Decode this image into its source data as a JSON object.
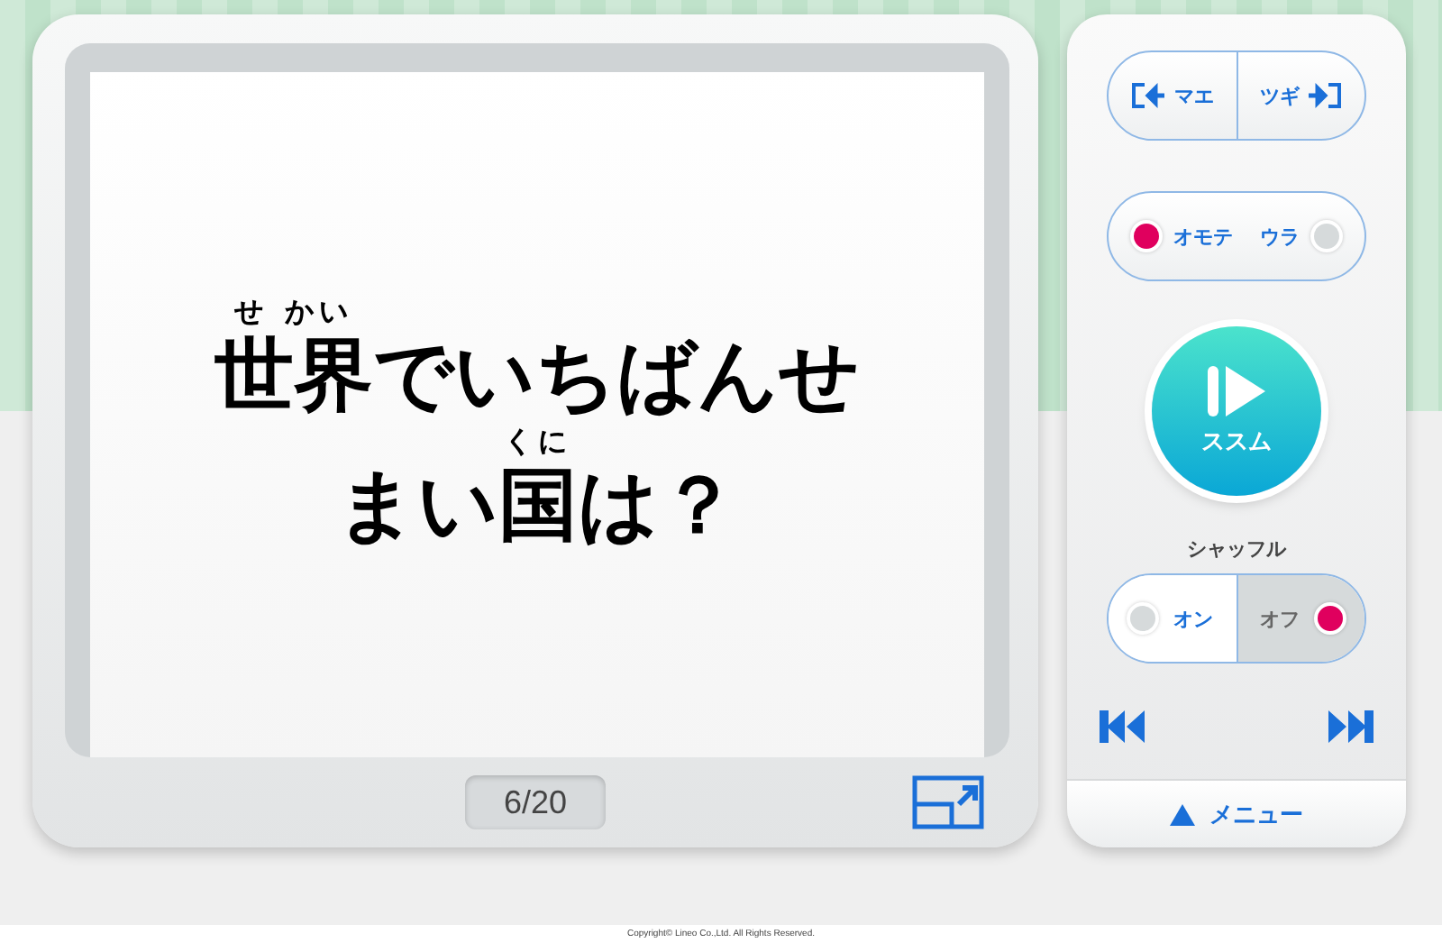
{
  "question": {
    "lines": [
      [
        {
          "text": "世界",
          "ruby": "せ かい"
        },
        {
          "text": "でいちばんせ"
        }
      ],
      [
        {
          "text": "まい"
        },
        {
          "text": "国",
          "ruby": "くに"
        },
        {
          "text": "は？"
        }
      ]
    ]
  },
  "counter": "6/20",
  "nav": {
    "prev": "マエ",
    "next": "ツギ"
  },
  "toggles": [
    {
      "kind": "pill",
      "options": [
        {
          "label": "オモテ",
          "selected": true
        },
        {
          "label": "ウラ",
          "selected": false
        }
      ]
    },
    {
      "kind": "segmented",
      "label": "シャッフル",
      "options": [
        {
          "label": "オン",
          "selected": false
        },
        {
          "label": "オフ",
          "selected": true
        }
      ]
    }
  ],
  "advance_button": "ススム",
  "menu_button": "メニュー",
  "copyright": "Copyright© Lineo Co.,Ltd. All Rights Reserved."
}
